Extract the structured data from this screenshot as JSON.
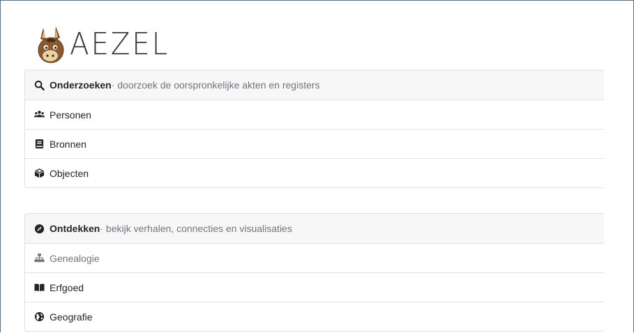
{
  "logo": {
    "text": "AEZEL",
    "icon": "donkey-logo-icon"
  },
  "research": {
    "title": "Onderzoeken",
    "subtitle": " · doorzoek de oorspronkelijke akten en registers",
    "icon": "search-icon",
    "items": [
      {
        "label": "Personen",
        "icon": "users-icon"
      },
      {
        "label": "Bronnen",
        "icon": "book-icon"
      },
      {
        "label": "Objecten",
        "icon": "cube-icon"
      }
    ]
  },
  "discover": {
    "title": "Ontdekken",
    "subtitle": " · bekijk verhalen, connecties en visualisaties",
    "icon": "compass-icon",
    "items": [
      {
        "label": "Genealogie",
        "icon": "sitemap-icon",
        "state": "disabled"
      },
      {
        "label": "Erfgoed",
        "icon": "book-open-icon"
      },
      {
        "label": "Geografie",
        "icon": "globe-icon"
      }
    ]
  }
}
